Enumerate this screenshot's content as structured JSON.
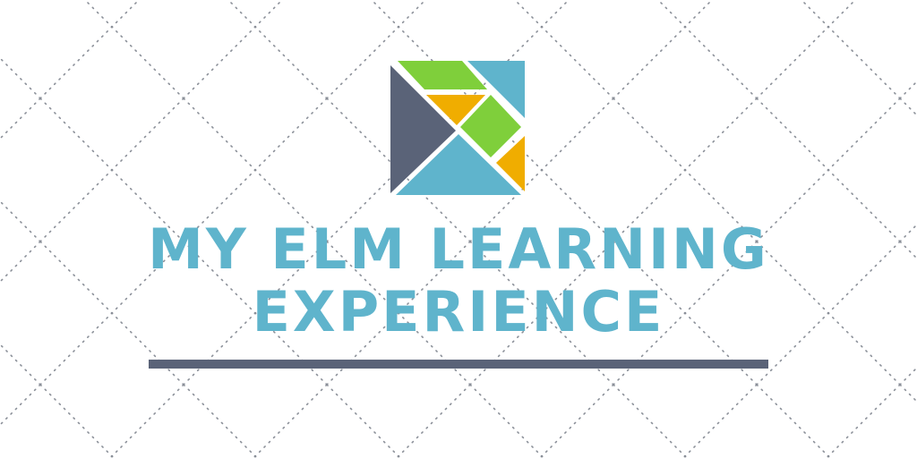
{
  "title": {
    "line1": "MY ELM LEARNING",
    "line2": "EXPERIENCE"
  },
  "logo": {
    "icon": "elm-tangram-icon",
    "colors": {
      "dark": "#5a6378",
      "blue": "#5fb4cc",
      "green": "#7fcf3b",
      "orange": "#f0ad00"
    }
  },
  "colors": {
    "background": "#ffffff",
    "title_text": "#5fb4cc",
    "underline": "#5a6378",
    "pattern_dots": "#8a8f98"
  }
}
